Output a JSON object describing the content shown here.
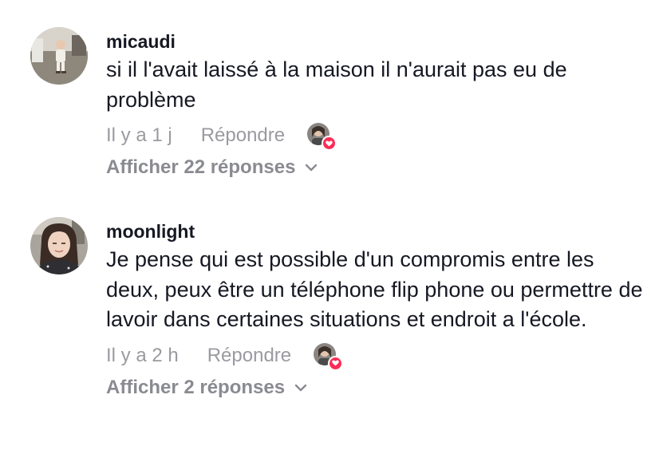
{
  "comments": [
    {
      "username": "micaudi",
      "text": "si il l'avait laissé à la maison il n'aurait pas eu de problème",
      "time": "Il y a 1 j",
      "reply_label": "Répondre",
      "show_replies": "Afficher 22 réponses"
    },
    {
      "username": "moonlight",
      "text": "Je pense qui est possible d'un compromis entre les deux, peux être un téléphone flip phone ou permettre de lavoir dans certaines situations et endroit a l'école.",
      "time": "Il y a 2 h",
      "reply_label": "Répondre",
      "show_replies": "Afficher 2 réponses"
    }
  ],
  "colors": {
    "text": "#161823",
    "secondary": "#9a9aa0",
    "heart": "#fe2c55"
  },
  "icons": {
    "avatar_1": "avatar-child-photo",
    "avatar_2": "avatar-woman-photo",
    "creator_liked": "creator-liked-heart-icon",
    "expand": "chevron-down-icon"
  }
}
